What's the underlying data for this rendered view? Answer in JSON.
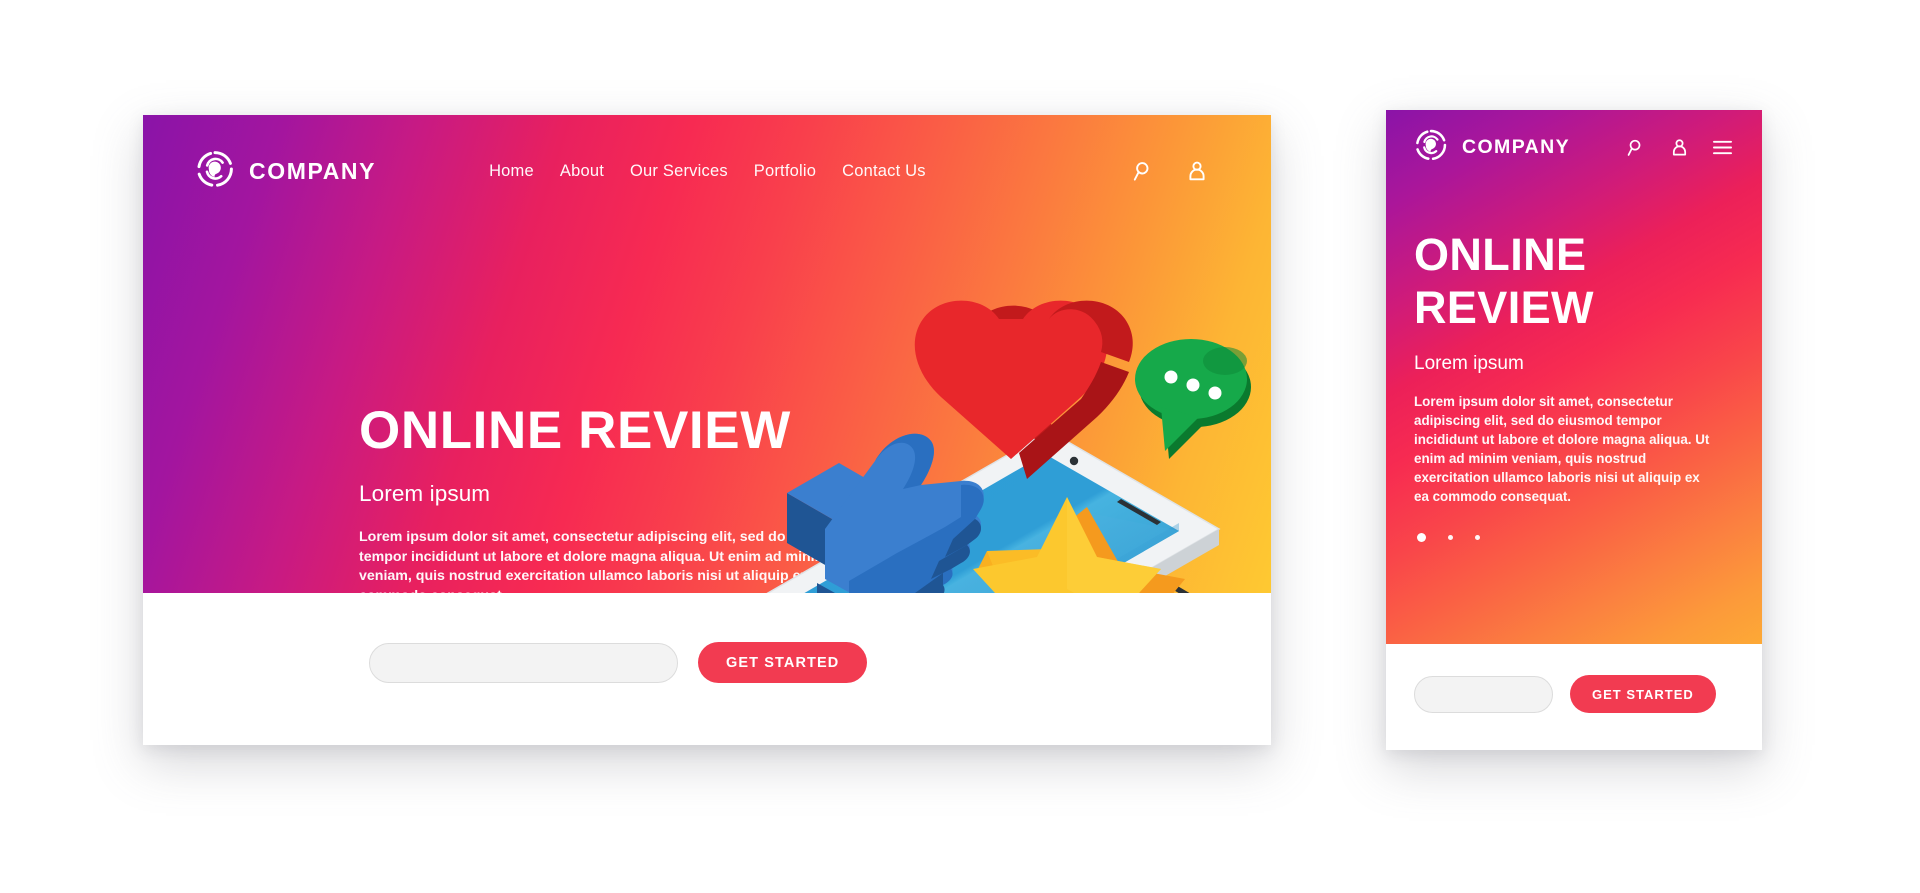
{
  "colors": {
    "gradient_start": "#8a14a8",
    "gradient_mid": "#f72a52",
    "gradient_end": "#fec932",
    "cta_red": "#f23b51",
    "card_white": "#ffffff",
    "heart_red": "#e8272b",
    "bubble_green": "#0f9b3d",
    "thumb_blue": "#2a6fc0",
    "star_yellow": "#fcc82e",
    "phone_screen_blue": "#2a9ad4",
    "page_background": "#ffffff"
  },
  "desktop": {
    "brand": {
      "name": "COMPANY",
      "logo_icon": "circular-swirl-logo-icon"
    },
    "nav": [
      {
        "label": "Home"
      },
      {
        "label": "About"
      },
      {
        "label": "Our Services"
      },
      {
        "label": "Portfolio"
      },
      {
        "label": "Contact Us"
      }
    ],
    "actions": [
      {
        "icon": "search-icon"
      },
      {
        "icon": "user-icon"
      }
    ],
    "hero": {
      "title": "ONLINE REVIEW",
      "subtitle": "Lorem ipsum",
      "body": "Lorem ipsum dolor sit amet, consectetur adipiscing elit, sed do eiusmod tempor incididunt ut labore et dolore magna aliqua. Ut enim ad minim veniam, quis nostrud exercitation ullamco laboris nisi ut aliquip ex ea commodo consequat."
    },
    "carousel": {
      "total": 3,
      "active_index": 0
    },
    "footer": {
      "input_value": "",
      "input_placeholder": "",
      "cta_label": "GET STARTED"
    }
  },
  "mobile": {
    "brand": {
      "name": "COMPANY",
      "logo_icon": "circular-swirl-logo-icon"
    },
    "actions": [
      {
        "icon": "search-icon"
      },
      {
        "icon": "user-icon"
      },
      {
        "icon": "hamburger-menu-icon"
      }
    ],
    "hero": {
      "title_line1": "ONLINE",
      "title_line2": "REVIEW",
      "subtitle": "Lorem ipsum",
      "body": "Lorem ipsum dolor sit amet, consectetur adipiscing elit, sed do eiusmod tempor incididunt ut labore et dolore magna aliqua. Ut enim ad minim veniam, quis nostrud exercitation ullamco laboris nisi ut aliquip ex ea commodo consequat."
    },
    "carousel": {
      "total": 3,
      "active_index": 0
    },
    "footer": {
      "input_value": "",
      "input_placeholder": "",
      "cta_label": "GET STARTED"
    }
  },
  "illustration": {
    "elements": [
      {
        "name": "isometric-heart",
        "color": "#e8272b"
      },
      {
        "name": "isometric-speech-bubble",
        "color": "#0f9b3d"
      },
      {
        "name": "isometric-thumbs-up",
        "color": "#2a6fc0"
      },
      {
        "name": "isometric-star",
        "color": "#fcc82e"
      },
      {
        "name": "isometric-smartphone",
        "color": "#2a9ad4"
      }
    ]
  }
}
